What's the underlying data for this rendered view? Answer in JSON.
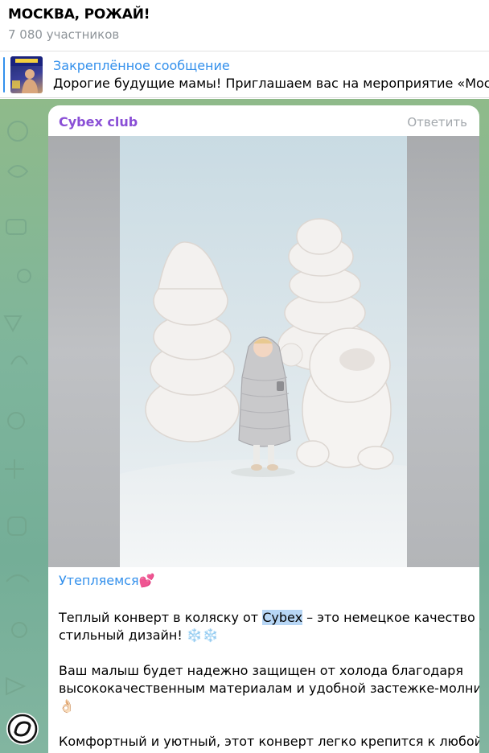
{
  "header": {
    "title": "МОСКВА, РОЖАЙ!",
    "subtitle": "7 080 участников"
  },
  "pinned": {
    "title": "Закреплённое сообщение",
    "text": "Дорогие будущие мамы!   Приглашаем вас на мероприятие «Москва"
  },
  "message": {
    "sender": "Cybex club",
    "reply_label": "Ответить",
    "hashtag": "Утепляемся",
    "hashtag_emoji": "💕",
    "para1_line1_before": "Теплый конверт в коляску от ",
    "para1_line1_highlight": "Cybex",
    "para1_line1_after": " – это немецкое качество и",
    "para1_line2": "стильный дизайн! ",
    "para1_emoji": "❄️❄️",
    "para2_line1": "Ваш малыш будет надежно защищен от холода благодаря",
    "para2_line2": "высококачественным материалам и удобной застежке-молнии",
    "para2_emoji": "👌🏻",
    "para3_line1": "Комфортный и уютный, этот конверт легко крепится к любой"
  },
  "icons": {
    "scroll_button": "channel-logo-icon"
  },
  "colors": {
    "accent": "#3390ec",
    "sender": "#8a4fd6",
    "chat_background": "#7eb59c",
    "mention_highlight": "#b7d6f5"
  }
}
